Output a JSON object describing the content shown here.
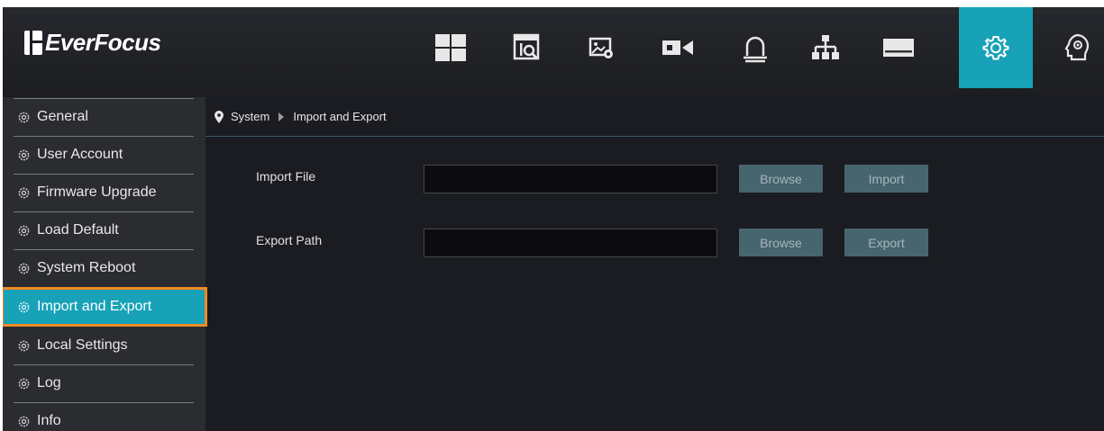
{
  "brand": {
    "logo_text": "EverFocus"
  },
  "nav": {
    "icons": [
      "layout-grid-icon",
      "playback-search-icon",
      "image-settings-icon",
      "camera-icon",
      "alarm-icon",
      "network-icon",
      "storage-icon",
      "settings-gear-icon",
      "system-info-icon"
    ],
    "active": "settings-gear-icon"
  },
  "sidebar": {
    "items": [
      {
        "label": "General"
      },
      {
        "label": "User Account"
      },
      {
        "label": "Firmware Upgrade"
      },
      {
        "label": "Load Default"
      },
      {
        "label": "System Reboot"
      },
      {
        "label": "Import and Export"
      },
      {
        "label": "Local Settings"
      },
      {
        "label": "Log"
      },
      {
        "label": "Info"
      }
    ],
    "active_index": 5
  },
  "breadcrumb": {
    "root": "System",
    "current": "Import and Export"
  },
  "form": {
    "import_label": "Import File",
    "import_value": "",
    "import_browse": "Browse",
    "import_action": "Import",
    "export_label": "Export Path",
    "export_value": "",
    "export_browse": "Browse",
    "export_action": "Export"
  },
  "colors": {
    "accent": "#17a2b8",
    "highlight_outline": "#f08a24",
    "background": "#1b1c21",
    "sidebar": "#2b2c30",
    "button": "#47656f"
  }
}
